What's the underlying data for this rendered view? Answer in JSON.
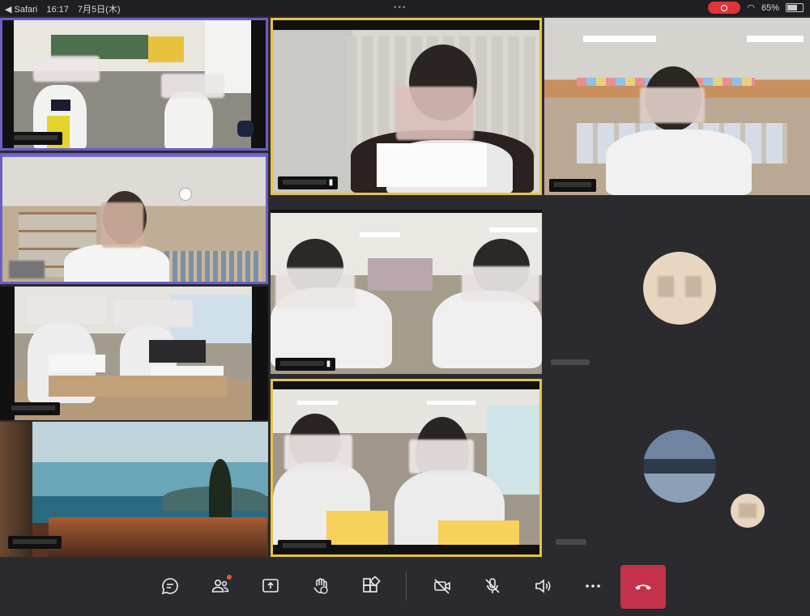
{
  "status_bar": {
    "back_app": "◀ Safari",
    "time": "16:17",
    "date": "7月5日(木)",
    "battery": "65%"
  },
  "participants": [
    {
      "tile": "classroom-1",
      "name": "",
      "state": "spotlight"
    },
    {
      "tile": "teacher-library",
      "name": "",
      "state": "spotlight"
    },
    {
      "tile": "classroom-3",
      "name": "",
      "state": "normal"
    },
    {
      "tile": "landscape-bg",
      "name": "",
      "state": "normal"
    },
    {
      "tile": "student-center-top",
      "name": "",
      "state": "speaking"
    },
    {
      "tile": "two-students",
      "name": "",
      "state": "normal"
    },
    {
      "tile": "students-yellow-cards",
      "name": "",
      "state": "speaking"
    },
    {
      "tile": "student-right-top",
      "name": "",
      "state": "normal"
    }
  ],
  "toolbar": {
    "buttons": [
      {
        "name": "chat",
        "icon": "chat-icon"
      },
      {
        "name": "participants",
        "icon": "people-icon"
      },
      {
        "name": "share",
        "icon": "share-screen-icon"
      },
      {
        "name": "reactions",
        "icon": "raise-hand-icon"
      },
      {
        "name": "apps",
        "icon": "apps-icon"
      },
      {
        "name": "camera",
        "icon": "camera-off-icon"
      },
      {
        "name": "mic",
        "icon": "mic-off-icon"
      },
      {
        "name": "speaker",
        "icon": "speaker-icon"
      },
      {
        "name": "more",
        "icon": "more-icon"
      },
      {
        "name": "leave",
        "icon": "hang-up-icon"
      }
    ]
  },
  "colors": {
    "spotlight_border": "#6b5fc7",
    "speaking_border": "#e6c24a",
    "hangup": "#c4314b",
    "background": "#2b2a2f"
  }
}
